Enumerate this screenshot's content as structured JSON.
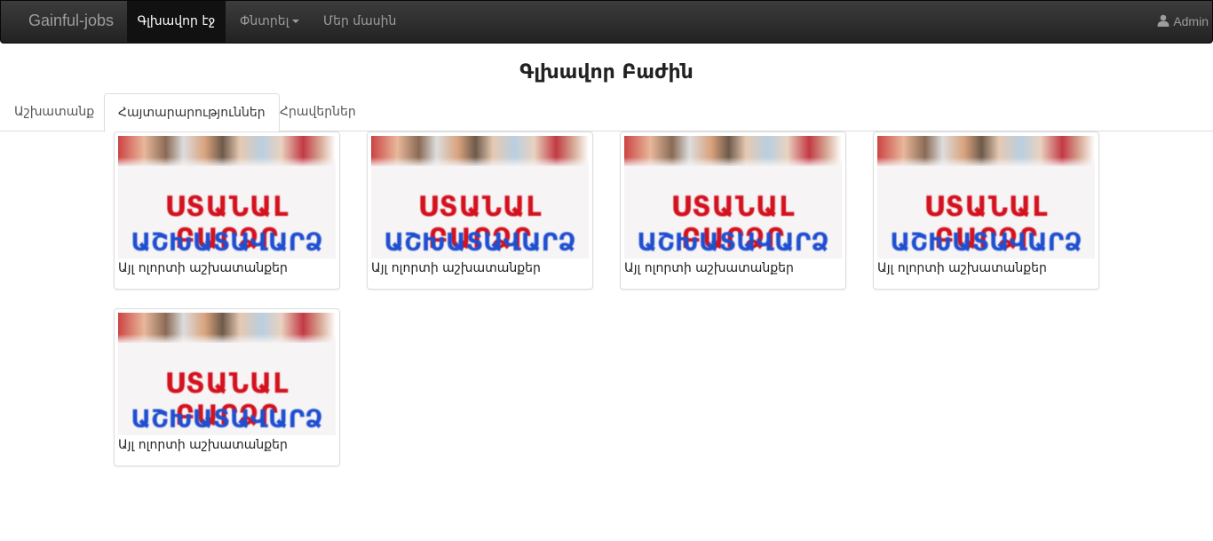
{
  "navbar": {
    "brand": "Gainful-jobs",
    "items": [
      {
        "label": "Գլխավոր էջ"
      },
      {
        "label": "Փնտրել"
      },
      {
        "label": "Մեր մասին"
      }
    ],
    "user": "Admin",
    "user_icon": "user-icon"
  },
  "page": {
    "title": "Գլխավոր Բաժին"
  },
  "tabs": [
    {
      "label": "Աշխատանք"
    },
    {
      "label": "Հայտարարություններ"
    },
    {
      "label": "Հրավերներ"
    }
  ],
  "cards": [
    {
      "banner_line1": "ՍՏԱՆԱԼ ԲԱՐՁՐ",
      "banner_line2": "ԱՇԽԱՏԱՎԱՐՁ",
      "caption": "Այլ ոլորտի աշխատանքեր"
    },
    {
      "banner_line1": "ՍՏԱՆԱԼ ԲԱՐՁՐ",
      "banner_line2": "ԱՇԽԱՏԱՎԱՐՁ",
      "caption": "Այլ ոլորտի աշխատանքեր"
    },
    {
      "banner_line1": "ՍՏԱՆԱԼ ԲԱՐՁՐ",
      "banner_line2": "ԱՇԽԱՏԱՎԱՐՁ",
      "caption": "Այլ ոլորտի աշխատանքեր"
    },
    {
      "banner_line1": "ՍՏԱՆԱԼ ԲԱՐՁՐ",
      "banner_line2": "ԱՇԽԱՏԱՎԱՐՁ",
      "caption": "Այլ ոլորտի աշխատանքեր"
    },
    {
      "banner_line1": "ՍՏԱՆԱԼ ԲԱՐՁՐ",
      "banner_line2": "ԱՇԽԱՏԱՎԱՐՁ",
      "caption": "Այլ ոլորտի աշխատանքեր"
    }
  ],
  "colors": {
    "navbar_bg": "#222222",
    "banner_red": "#d4111e",
    "banner_blue": "#1f4fd0"
  }
}
